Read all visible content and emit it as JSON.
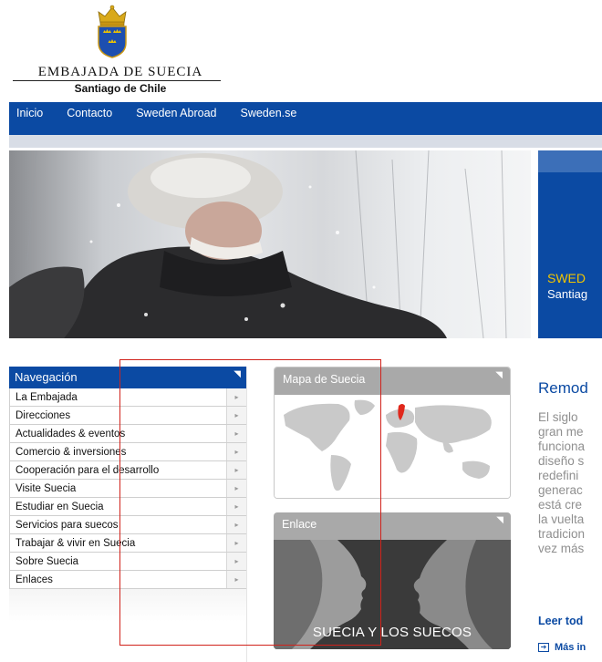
{
  "logo": {
    "title": "EMBAJADA DE SUECIA",
    "subtitle": "Santiago de Chile",
    "icon": "royal-crown-coat-of-arms"
  },
  "topnav": {
    "items": [
      {
        "label": "Inicio"
      },
      {
        "label": "Contacto"
      },
      {
        "label": "Sweden Abroad"
      },
      {
        "label": "Sweden.se"
      }
    ]
  },
  "hero": {
    "panel_title": "SWED",
    "panel_subtitle": "Santiag"
  },
  "leftnav": {
    "title": "Navegación",
    "items": [
      {
        "label": "La Embajada"
      },
      {
        "label": "Direcciones"
      },
      {
        "label": "Actualidades & eventos"
      },
      {
        "label": "Comercio & inversiones"
      },
      {
        "label": "Cooperación para el desarrollo"
      },
      {
        "label": "Visite Suecia"
      },
      {
        "label": "Estudiar en Suecia"
      },
      {
        "label": "Servicios para suecos"
      },
      {
        "label": "Trabajar & vivir en Suecia"
      },
      {
        "label": "Sobre Suecia"
      },
      {
        "label": "Enlaces"
      }
    ]
  },
  "widgets": {
    "map_title": "Mapa de Suecia",
    "link_title": "Enlace",
    "link_caption": "SUECIA Y LOS SUECOS"
  },
  "article": {
    "title": "Remod",
    "lines": [
      "El siglo",
      "gran me",
      "funciona",
      "diseño s",
      "redefini",
      "generac",
      "está cre",
      "la vuelta",
      "tradicion",
      "vez más"
    ],
    "read_more": "Leer tod",
    "more_link": "Más in"
  },
  "colors": {
    "brand_blue": "#0b4aa3",
    "accent_yellow": "#f0c400",
    "widget_gray": "#a9a9a9",
    "highlight_red": "#d0221b",
    "sweden_map_red": "#e0281c"
  }
}
